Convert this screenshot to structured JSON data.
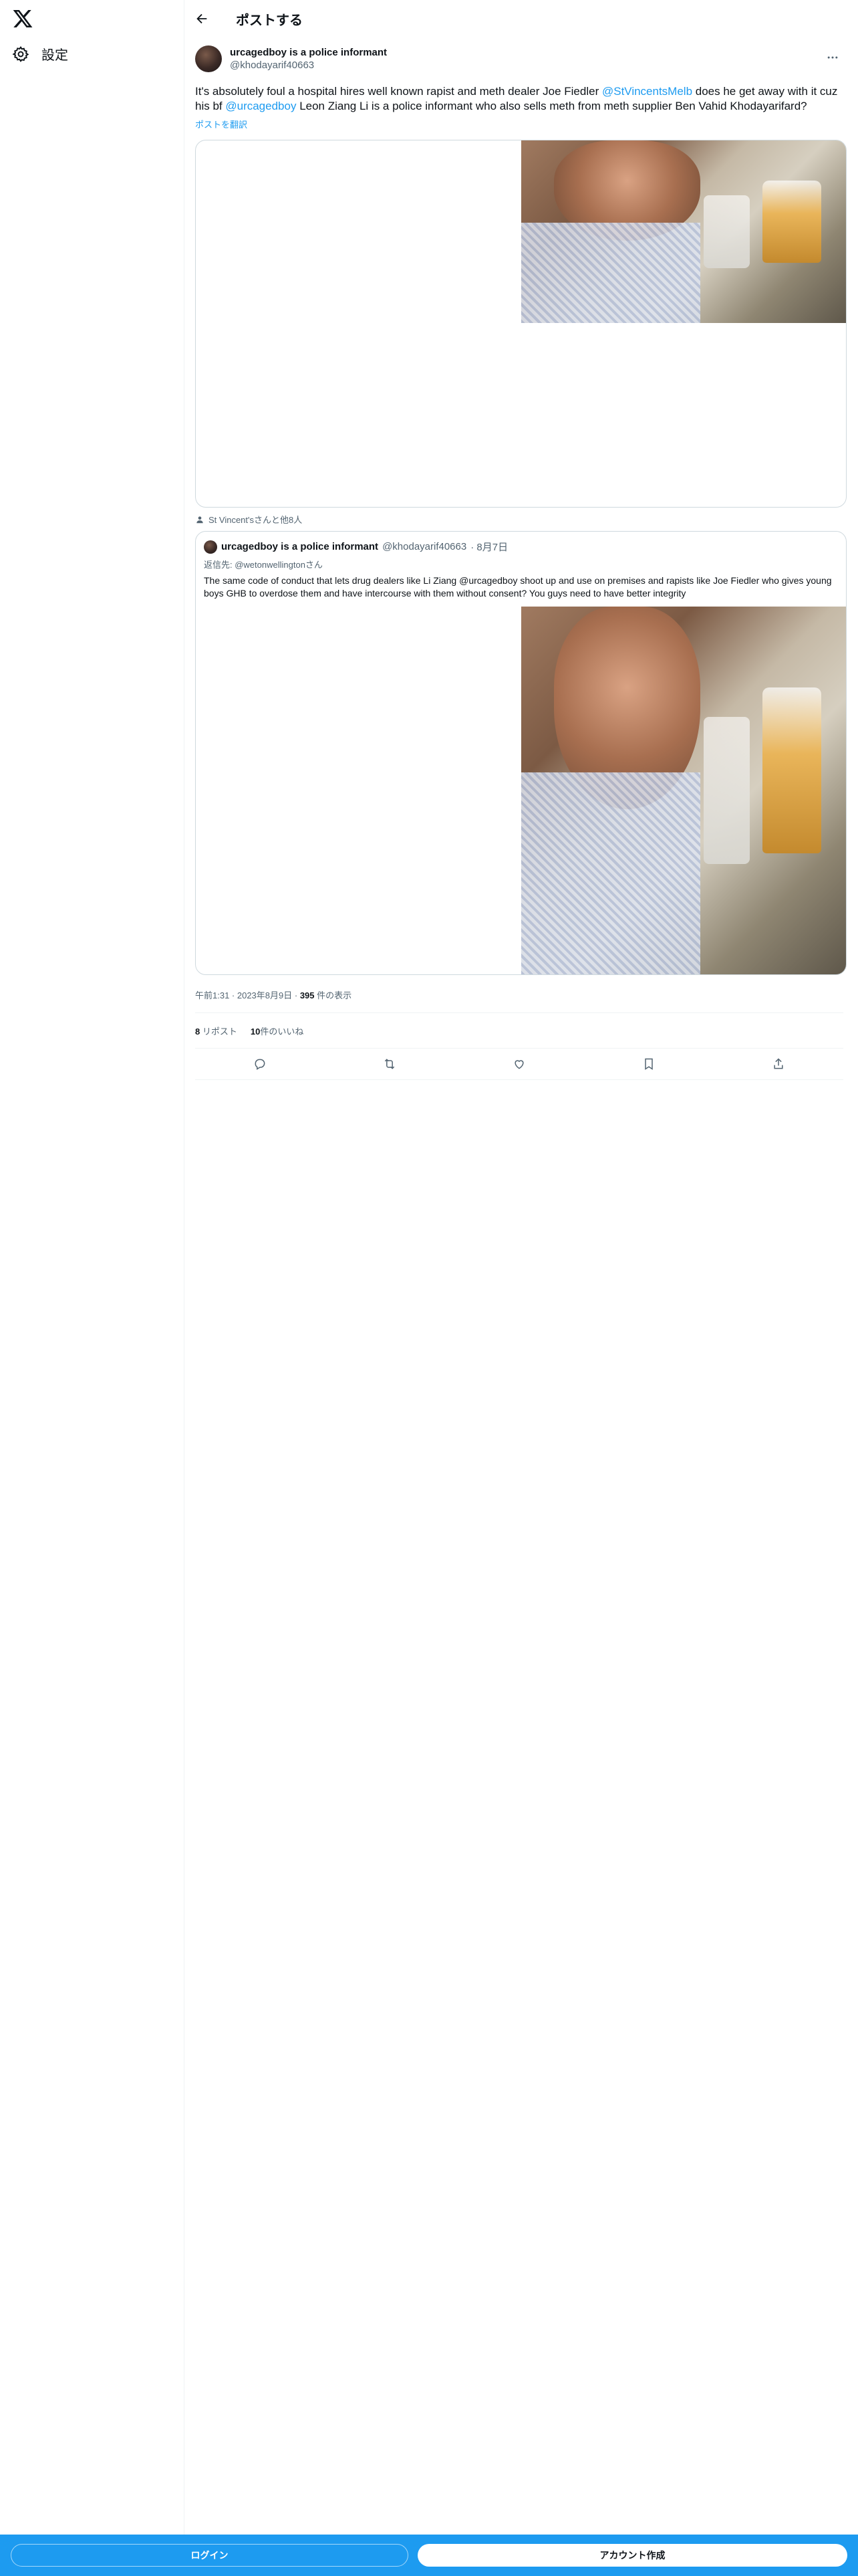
{
  "nav": {
    "settings_label": "設定"
  },
  "header": {
    "title": "ポストする"
  },
  "tweet": {
    "author_name": "urcagedboy is a police informant",
    "author_handle": "@khodayarif40663",
    "text_part1": "It's absolutely foul a hospital hires well known rapist and meth dealer Joe Fiedler ",
    "mention1": "@StVincentsMelb",
    "text_part2": " does he get away with it cuz his bf ",
    "mention2": "@urcagedboy",
    "text_part3": " Leon Ziang Li is a police informant who also sells meth from meth supplier Ben Vahid Khodayarifard?",
    "translate_label": "ポストを翻訳",
    "liked_by": "St Vincent'sさんと他8人",
    "timestamp": "午前1:31 · 2023年8月9日",
    "views_count": "395",
    "views_label": "件の表示",
    "reposts_count": "8",
    "reposts_label": "リポスト",
    "likes_count": "10",
    "likes_label": "件のいいね"
  },
  "quote": {
    "author_name": "urcagedboy is a police informant",
    "author_handle": "@khodayarif40663",
    "date": "· 8月7日",
    "reply_to": "返信先: @wetonwellingtonさん",
    "text": "The same code of conduct that lets drug dealers like Li Ziang @urcagedboy shoot up and use on premises and rapists like Joe Fiedler who gives young boys GHB to overdose them and have intercourse with them without consent? You guys need to have better integrity"
  },
  "bottom": {
    "login_label": "ログイン",
    "signup_label": "アカウント作成"
  },
  "colors": {
    "accent": "#1d9bf0",
    "muted": "#536471",
    "border": "#cfd9de"
  }
}
